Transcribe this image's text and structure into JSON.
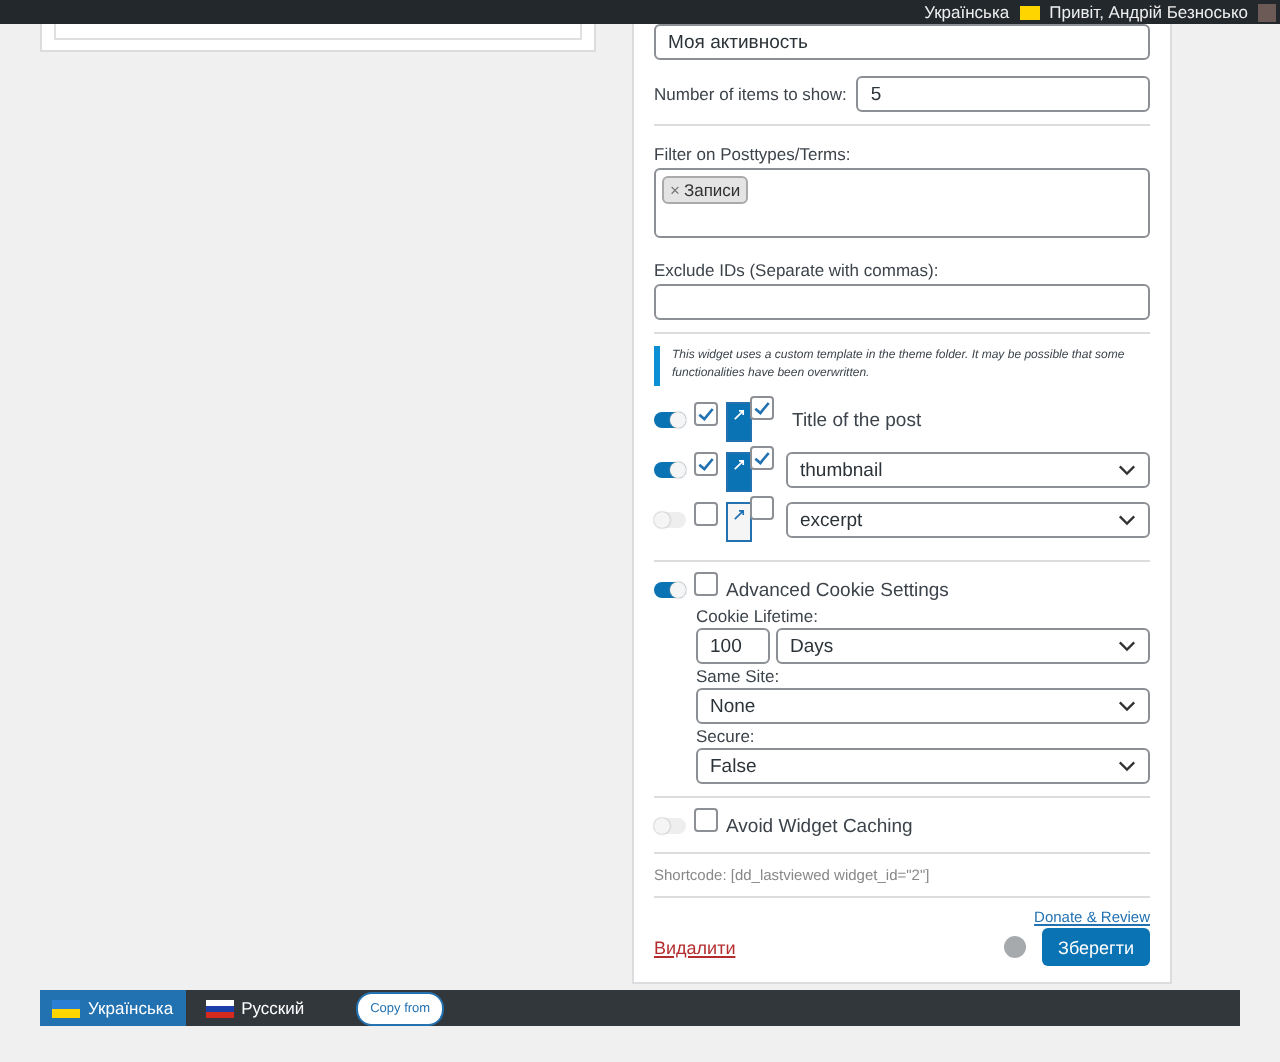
{
  "admin_bar": {
    "language": "Українська",
    "greeting": "Привіт, Андрій Безносько"
  },
  "widget": {
    "title_value": "Моя активность",
    "items_label": "Number of items to show:",
    "items_value": "5",
    "filter_label": "Filter on Posttypes/Terms:",
    "filter_tags": [
      {
        "remove": "×",
        "label": "Записи"
      }
    ],
    "exclude_label": "Exclude IDs (Separate with commas):",
    "notice": "This widget uses a custom template in the theme folder. It may be possible that some functionalities have been overwritten.",
    "fields": [
      {
        "on": true,
        "checked": true,
        "linked": true,
        "link_checked": true,
        "kind": "text",
        "label": "Title of the post"
      },
      {
        "on": true,
        "checked": true,
        "linked": true,
        "link_checked": true,
        "kind": "select",
        "label": "thumbnail"
      },
      {
        "on": false,
        "checked": false,
        "linked": false,
        "link_checked": false,
        "kind": "select",
        "label": "excerpt"
      }
    ],
    "cookie": {
      "on": true,
      "checked": false,
      "label": "Advanced Cookie Settings",
      "lifetime_label": "Cookie Lifetime:",
      "lifetime_value": "100",
      "lifetime_unit": "Days",
      "same_site_label": "Same Site:",
      "same_site_value": "None",
      "secure_label": "Secure:",
      "secure_value": "False"
    },
    "caching": {
      "on": false,
      "checked": false,
      "label": "Avoid Widget Caching"
    },
    "shortcode": "Shortcode: [dd_lastviewed widget_id=\"2\"]",
    "donate": "Donate & Review",
    "delete": "Видалити",
    "save": "Зберегти"
  },
  "language_tabs": [
    {
      "label": "Українська",
      "selected": true,
      "kind": "ua"
    },
    {
      "label": "Русский",
      "selected": false,
      "kind": "ru"
    }
  ],
  "copy_from": "Copy from"
}
